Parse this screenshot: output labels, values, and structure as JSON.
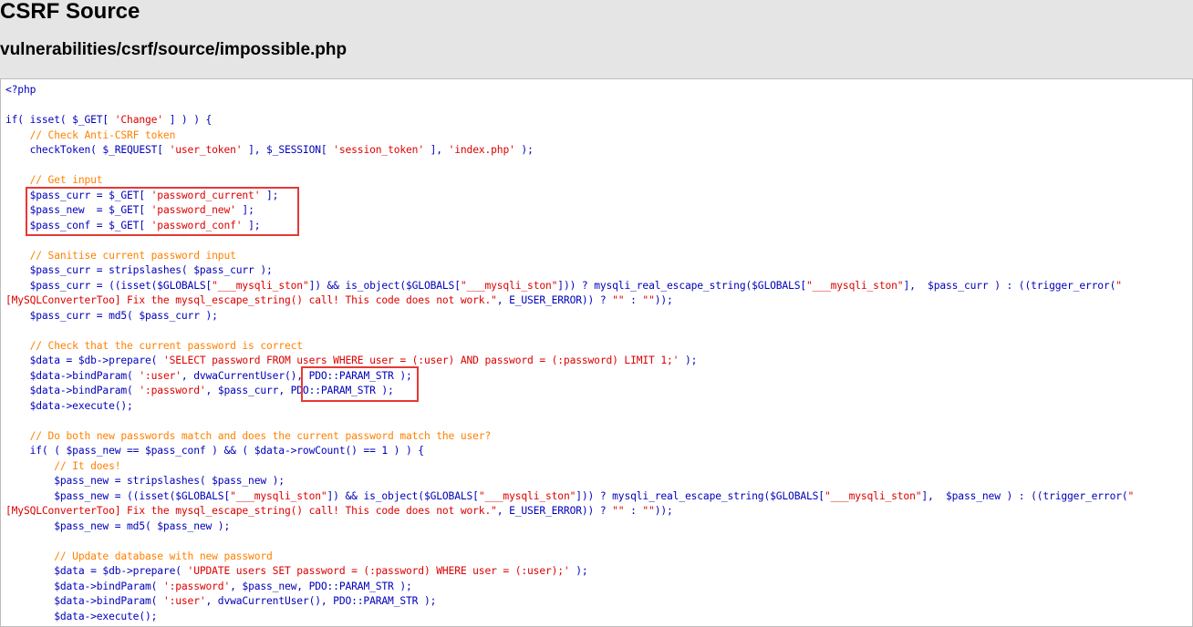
{
  "header": {
    "title": "CSRF Source",
    "file_path": "vulnerabilities/csrf/source/impossible.php"
  },
  "code": {
    "lines": [
      [
        {
          "t": "<?php",
          "c": "kw"
        }
      ],
      [],
      [
        {
          "t": "if( isset( $_GET[ ",
          "c": "kw"
        },
        {
          "t": "'Change'",
          "c": "str"
        },
        {
          "t": " ] ) ) {",
          "c": "kw"
        }
      ],
      [
        {
          "t": "    // Check Anti-CSRF token",
          "c": "cm"
        }
      ],
      [
        {
          "t": "    checkToken( $_REQUEST[ ",
          "c": "kw"
        },
        {
          "t": "'user_token'",
          "c": "str"
        },
        {
          "t": " ], $_SESSION[ ",
          "c": "kw"
        },
        {
          "t": "'session_token'",
          "c": "str"
        },
        {
          "t": " ], ",
          "c": "kw"
        },
        {
          "t": "'index.php'",
          "c": "str"
        },
        {
          "t": " );",
          "c": "kw"
        }
      ],
      [],
      [
        {
          "t": "    // Get input",
          "c": "cm"
        }
      ],
      [
        {
          "t": "    $pass_curr = $_GET[ ",
          "c": "kw"
        },
        {
          "t": "'password_current'",
          "c": "str"
        },
        {
          "t": " ];",
          "c": "kw"
        }
      ],
      [
        {
          "t": "    $pass_new  = $_GET[ ",
          "c": "kw"
        },
        {
          "t": "'password_new'",
          "c": "str"
        },
        {
          "t": " ];",
          "c": "kw"
        }
      ],
      [
        {
          "t": "    $pass_conf = $_GET[ ",
          "c": "kw"
        },
        {
          "t": "'password_conf'",
          "c": "str"
        },
        {
          "t": " ];",
          "c": "kw"
        }
      ],
      [],
      [
        {
          "t": "    // Sanitise current password input",
          "c": "cm"
        }
      ],
      [
        {
          "t": "    $pass_curr = stripslashes( $pass_curr );",
          "c": "kw"
        }
      ],
      [
        {
          "t": "    $pass_curr = ((isset($GLOBALS[",
          "c": "kw"
        },
        {
          "t": "\"___mysqli_ston\"",
          "c": "str"
        },
        {
          "t": "]) && is_object($GLOBALS[",
          "c": "kw"
        },
        {
          "t": "\"___mysqli_ston\"",
          "c": "str"
        },
        {
          "t": "])) ? mysqli_real_escape_string($GLOBALS[",
          "c": "kw"
        },
        {
          "t": "\"___mysqli_ston\"",
          "c": "str"
        },
        {
          "t": "],  $pass_curr ) : ((trigger_error(",
          "c": "kw"
        },
        {
          "t": "\"",
          "c": "str"
        }
      ],
      [
        {
          "t": "[MySQLConverterToo] Fix the mysql_escape_string() call! This code does not work.\"",
          "c": "str"
        },
        {
          "t": ", E_USER_ERROR)) ? ",
          "c": "kw"
        },
        {
          "t": "\"\"",
          "c": "str"
        },
        {
          "t": " : ",
          "c": "kw"
        },
        {
          "t": "\"\"",
          "c": "str"
        },
        {
          "t": "));",
          "c": "kw"
        }
      ],
      [
        {
          "t": "    $pass_curr = md5( $pass_curr );",
          "c": "kw"
        }
      ],
      [],
      [
        {
          "t": "    // Check that the current password is correct",
          "c": "cm"
        }
      ],
      [
        {
          "t": "    $data = $db->prepare( ",
          "c": "kw"
        },
        {
          "t": "'SELECT password FROM users WHERE user = (:user) AND password = (:password) LIMIT 1;'",
          "c": "str"
        },
        {
          "t": " );",
          "c": "kw"
        }
      ],
      [
        {
          "t": "    $data->bindParam( ",
          "c": "kw"
        },
        {
          "t": "':user'",
          "c": "str"
        },
        {
          "t": ", dvwaCurrentUser(), PDO::PARAM_STR );",
          "c": "kw"
        }
      ],
      [
        {
          "t": "    $data->bindParam( ",
          "c": "kw"
        },
        {
          "t": "':password'",
          "c": "str"
        },
        {
          "t": ", $pass_curr, PDO::PARAM_STR );",
          "c": "kw"
        }
      ],
      [
        {
          "t": "    $data->execute();",
          "c": "kw"
        }
      ],
      [],
      [
        {
          "t": "    // Do both new passwords match and does the current password match the user?",
          "c": "cm"
        }
      ],
      [
        {
          "t": "    if( ( $pass_new == $pass_conf ) && ( $data->rowCount() == 1 ) ) {",
          "c": "kw"
        }
      ],
      [
        {
          "t": "        // It does!",
          "c": "cm"
        }
      ],
      [
        {
          "t": "        $pass_new = stripslashes( $pass_new );",
          "c": "kw"
        }
      ],
      [
        {
          "t": "        $pass_new = ((isset($GLOBALS[",
          "c": "kw"
        },
        {
          "t": "\"___mysqli_ston\"",
          "c": "str"
        },
        {
          "t": "]) && is_object($GLOBALS[",
          "c": "kw"
        },
        {
          "t": "\"___mysqli_ston\"",
          "c": "str"
        },
        {
          "t": "])) ? mysqli_real_escape_string($GLOBALS[",
          "c": "kw"
        },
        {
          "t": "\"___mysqli_ston\"",
          "c": "str"
        },
        {
          "t": "],  $pass_new ) : ((trigger_error(",
          "c": "kw"
        },
        {
          "t": "\"",
          "c": "str"
        }
      ],
      [
        {
          "t": "[MySQLConverterToo] Fix the mysql_escape_string() call! This code does not work.\"",
          "c": "str"
        },
        {
          "t": ", E_USER_ERROR)) ? ",
          "c": "kw"
        },
        {
          "t": "\"\"",
          "c": "str"
        },
        {
          "t": " : ",
          "c": "kw"
        },
        {
          "t": "\"\"",
          "c": "str"
        },
        {
          "t": "));",
          "c": "kw"
        }
      ],
      [
        {
          "t": "        $pass_new = md5( $pass_new );",
          "c": "kw"
        }
      ],
      [],
      [
        {
          "t": "        // Update database with new password",
          "c": "cm"
        }
      ],
      [
        {
          "t": "        $data = $db->prepare( ",
          "c": "kw"
        },
        {
          "t": "'UPDATE users SET password = (:password) WHERE user = (:user);'",
          "c": "str"
        },
        {
          "t": " );",
          "c": "kw"
        }
      ],
      [
        {
          "t": "        $data->bindParam( ",
          "c": "kw"
        },
        {
          "t": "':password'",
          "c": "str"
        },
        {
          "t": ", $pass_new, PDO::PARAM_STR );",
          "c": "kw"
        }
      ],
      [
        {
          "t": "        $data->bindParam( ",
          "c": "kw"
        },
        {
          "t": "':user'",
          "c": "str"
        },
        {
          "t": ", dvwaCurrentUser(), PDO::PARAM_STR );",
          "c": "kw"
        }
      ],
      [
        {
          "t": "        $data->execute();",
          "c": "kw"
        }
      ]
    ]
  },
  "colors": {
    "keyword": "#0000bb",
    "string": "#dd0000",
    "comment": "#ff8000",
    "highlight_box": "#e53935",
    "page_background": "#e5e5e5"
  }
}
